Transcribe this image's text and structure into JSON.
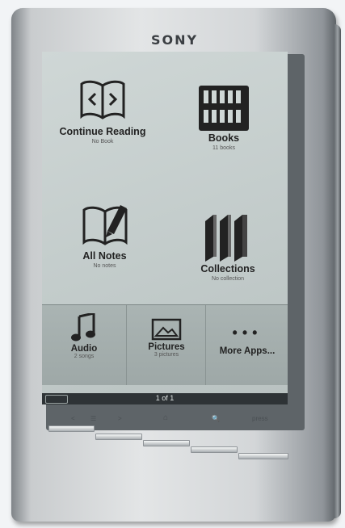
{
  "device": {
    "brand": "SONY"
  },
  "home": {
    "tiles": [
      {
        "title": "Continue Reading",
        "subtitle": "No Book",
        "icon": "open-book-code-icon"
      },
      {
        "title": "Books",
        "subtitle": "11 books",
        "icon": "bookshelf-icon"
      },
      {
        "title": "All Notes",
        "subtitle": "No notes",
        "icon": "notes-pen-icon"
      },
      {
        "title": "Collections",
        "subtitle": "No collection",
        "icon": "collections-icon"
      }
    ],
    "bottom": [
      {
        "title": "Audio",
        "subtitle": "2 songs",
        "icon": "music-note-icon"
      },
      {
        "title": "Pictures",
        "subtitle": "3 pictures",
        "icon": "picture-icon"
      },
      {
        "title": "More Apps...",
        "icon": "more-dots-icon"
      }
    ]
  },
  "status": {
    "page": "1 of 1",
    "left_badge": ""
  },
  "hardware_buttons": {
    "prev": "<",
    "menu": "☰",
    "next": ">",
    "home": "⌂",
    "zoom": "🔍",
    "power": "press"
  }
}
